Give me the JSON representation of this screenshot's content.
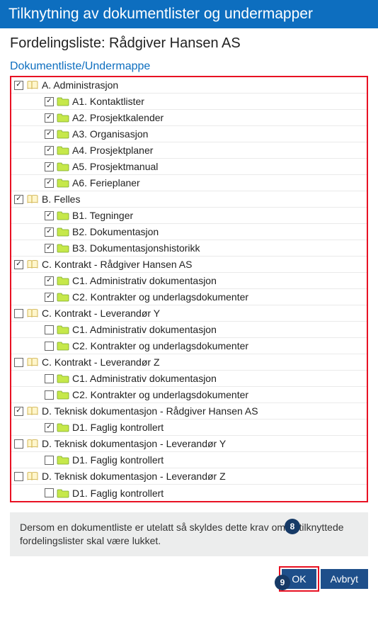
{
  "header": "Tilknytning av dokumentlister og undermapper",
  "subheader": "Fordelingsliste: Rådgiver Hansen AS",
  "section_title": "Dokumentliste/Undermappe",
  "info_text": "Dersom en dokumentliste er utelatt så skyldes dette krav om at tilknyttede fordelingslister skal være lukket.",
  "buttons": {
    "ok": "OK",
    "cancel": "Avbryt"
  },
  "badges": {
    "eight": "8",
    "nine": "9"
  },
  "tree": [
    {
      "label": "A. Administrasjon",
      "level": 0,
      "checked": true,
      "icon": "book"
    },
    {
      "label": "A1. Kontaktlister",
      "level": 1,
      "checked": true,
      "icon": "folder"
    },
    {
      "label": "A2. Prosjektkalender",
      "level": 1,
      "checked": true,
      "icon": "folder"
    },
    {
      "label": "A3. Organisasjon",
      "level": 1,
      "checked": true,
      "icon": "folder"
    },
    {
      "label": "A4. Prosjektplaner",
      "level": 1,
      "checked": true,
      "icon": "folder"
    },
    {
      "label": "A5. Prosjektmanual",
      "level": 1,
      "checked": true,
      "icon": "folder"
    },
    {
      "label": "A6. Ferieplaner",
      "level": 1,
      "checked": true,
      "icon": "folder"
    },
    {
      "label": "B. Felles",
      "level": 0,
      "checked": true,
      "icon": "book"
    },
    {
      "label": "B1. Tegninger",
      "level": 1,
      "checked": true,
      "icon": "folder"
    },
    {
      "label": "B2. Dokumentasjon",
      "level": 1,
      "checked": true,
      "icon": "folder"
    },
    {
      "label": "B3. Dokumentasjonshistorikk",
      "level": 1,
      "checked": true,
      "icon": "folder"
    },
    {
      "label": "C. Kontrakt - Rådgiver Hansen AS",
      "level": 0,
      "checked": true,
      "icon": "book"
    },
    {
      "label": "C1. Administrativ dokumentasjon",
      "level": 1,
      "checked": true,
      "icon": "folder"
    },
    {
      "label": "C2. Kontrakter og underlagsdokumenter",
      "level": 1,
      "checked": true,
      "icon": "folder"
    },
    {
      "label": "C. Kontrakt - Leverandør Y",
      "level": 0,
      "checked": false,
      "icon": "book"
    },
    {
      "label": "C1. Administrativ dokumentasjon",
      "level": 1,
      "checked": false,
      "icon": "folder"
    },
    {
      "label": "C2. Kontrakter og underlagsdokumenter",
      "level": 1,
      "checked": false,
      "icon": "folder"
    },
    {
      "label": "C. Kontrakt - Leverandør Z",
      "level": 0,
      "checked": false,
      "icon": "book"
    },
    {
      "label": "C1. Administrativ dokumentasjon",
      "level": 1,
      "checked": false,
      "icon": "folder"
    },
    {
      "label": "C2. Kontrakter og underlagsdokumenter",
      "level": 1,
      "checked": false,
      "icon": "folder"
    },
    {
      "label": "D. Teknisk dokumentasjon - Rådgiver Hansen AS",
      "level": 0,
      "checked": true,
      "icon": "book"
    },
    {
      "label": "D1. Faglig kontrollert",
      "level": 1,
      "checked": true,
      "icon": "folder"
    },
    {
      "label": "D. Teknisk dokumentasjon - Leverandør Y",
      "level": 0,
      "checked": false,
      "icon": "book"
    },
    {
      "label": "D1. Faglig kontrollert",
      "level": 1,
      "checked": false,
      "icon": "folder"
    },
    {
      "label": "D. Teknisk dokumentasjon - Leverandør Z",
      "level": 0,
      "checked": false,
      "icon": "book"
    },
    {
      "label": "D1. Faglig kontrollert",
      "level": 1,
      "checked": false,
      "icon": "folder"
    }
  ]
}
